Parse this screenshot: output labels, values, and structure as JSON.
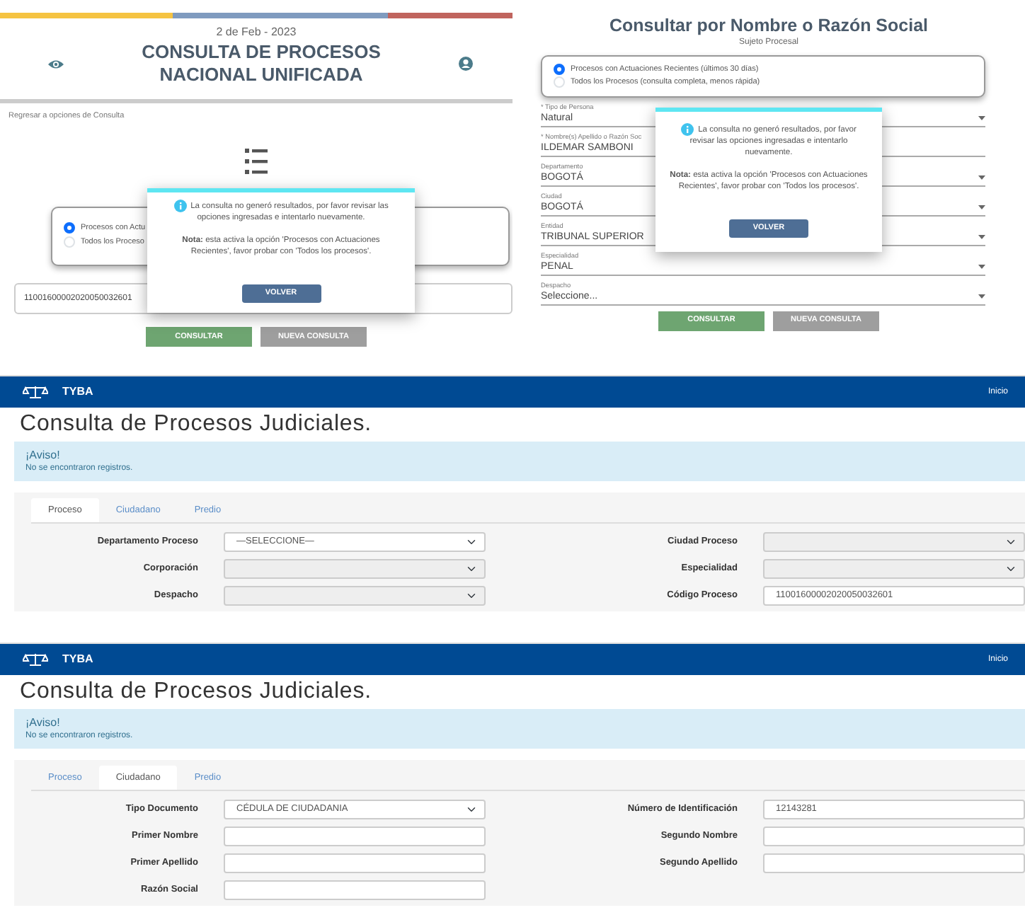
{
  "unified": {
    "date": "2 de Feb - 2023",
    "title": "CONSULTA DE PROCESOS NACIONAL UNIFICADA",
    "back_link": "Regresar a opciones de Consulta",
    "options": [
      {
        "label": "Procesos con Actu",
        "selected": true
      },
      {
        "label": "Todos los Proceso",
        "selected": false
      }
    ],
    "process_number": "11001600002020050032601",
    "buttons": [
      {
        "label": "CONSULTAR",
        "kind": "primary"
      },
      {
        "label": "NUEVA CONSULTA",
        "kind": "secondary"
      }
    ],
    "dialog": {
      "message": "La consulta no generó resultados, por favor revisar las opciones ingresadas e intentarlo nuevamente.",
      "note": "**Nota:** esta activa la opción 'Procesos con Actuaciones Recientes', favor probar con 'Todos los procesos'.",
      "button": "VOLVER"
    }
  },
  "by_name": {
    "title": "Consultar por Nombre o Razón Social",
    "subtitle": "Sujeto Procesal",
    "options": [
      {
        "label": "Procesos con Actuaciones Recientes (últimos 30 días)",
        "selected": true
      },
      {
        "label": "Todos los Procesos (consulta completa, menos rápida)",
        "selected": false
      }
    ],
    "fields": [
      {
        "label": "* Tipo de Persona",
        "value": "Natural",
        "kind": "select"
      },
      {
        "label": "* Nombre(s) Apellido o Razón Soc",
        "value": "ILDEMAR SAMBONI",
        "kind": "text"
      },
      {
        "label": "Departamento",
        "value": "BOGOTÁ",
        "kind": "select"
      },
      {
        "label": "Ciudad",
        "value": "BOGOTÁ",
        "kind": "select"
      },
      {
        "label": "Entidad",
        "value": "TRIBUNAL SUPERIOR",
        "kind": "select"
      },
      {
        "label": "Especialidad",
        "value": "PENAL",
        "kind": "select"
      },
      {
        "label": "Despacho",
        "value": "Seleccione...",
        "kind": "select"
      }
    ],
    "buttons": [
      {
        "label": "CONSULTAR",
        "kind": "primary"
      },
      {
        "label": "NUEVA CONSULTA",
        "kind": "secondary"
      }
    ],
    "dialog": {
      "message": "La consulta no generó resultados, por favor revisar las opciones ingresadas e intentarlo nuevamente.",
      "note": "**Nota:** esta activa la opción 'Procesos con Actuaciones Recientes', favor probar con 'Todos los procesos'.",
      "button": "VOLVER"
    }
  },
  "tyba_screens": [
    {
      "brand": "TYBA",
      "nav_link": "Inicio",
      "heading": "Consulta de Procesos Judiciales.",
      "alert": {
        "title": "¡Aviso!",
        "message": "No se encontraron registros."
      },
      "tabs": [
        {
          "label": "Proceso",
          "selected": true
        },
        {
          "label": "Ciudadano",
          "selected": false
        },
        {
          "label": "Predio",
          "selected": false
        }
      ],
      "rows": [
        [
          {
            "label": "Departamento Proceso",
            "value": "—SELECCIONE—",
            "kind": "select",
            "disabled": false
          },
          {
            "label": "Ciudad Proceso",
            "kind": "select",
            "disabled": true
          }
        ],
        [
          {
            "label": "Corporación",
            "kind": "select",
            "disabled": true
          },
          {
            "label": "Especialidad",
            "kind": "select",
            "disabled": true
          }
        ],
        [
          {
            "label": "Despacho",
            "kind": "select",
            "disabled": true
          },
          {
            "label": "Código Proceso",
            "value": "11001600002020050032601",
            "kind": "text",
            "disabled": false
          }
        ]
      ]
    },
    {
      "brand": "TYBA",
      "nav_link": "Inicio",
      "heading": "Consulta de Procesos Judiciales.",
      "alert": {
        "title": "¡Aviso!",
        "message": "No se encontraron registros."
      },
      "tabs": [
        {
          "label": "Proceso",
          "selected": false
        },
        {
          "label": "Ciudadano",
          "selected": true
        },
        {
          "label": "Predio",
          "selected": false
        }
      ],
      "rows": [
        [
          {
            "label": "Tipo Documento",
            "value": "CÉDULA DE CIUDADANIA",
            "kind": "select",
            "disabled": false
          },
          {
            "label": "Número de Identificación",
            "value": "12143281",
            "kind": "text",
            "disabled": false
          }
        ],
        [
          {
            "label": "Primer Nombre",
            "kind": "text",
            "disabled": false
          },
          {
            "label": "Segundo Nombre",
            "kind": "text",
            "disabled": false
          }
        ],
        [
          {
            "label": "Primer Apellido",
            "kind": "text",
            "disabled": false
          },
          {
            "label": "Segundo Apellido",
            "kind": "text",
            "disabled": false
          }
        ],
        [
          {
            "label": "Razón Social",
            "kind": "text",
            "disabled": false
          }
        ]
      ]
    }
  ]
}
